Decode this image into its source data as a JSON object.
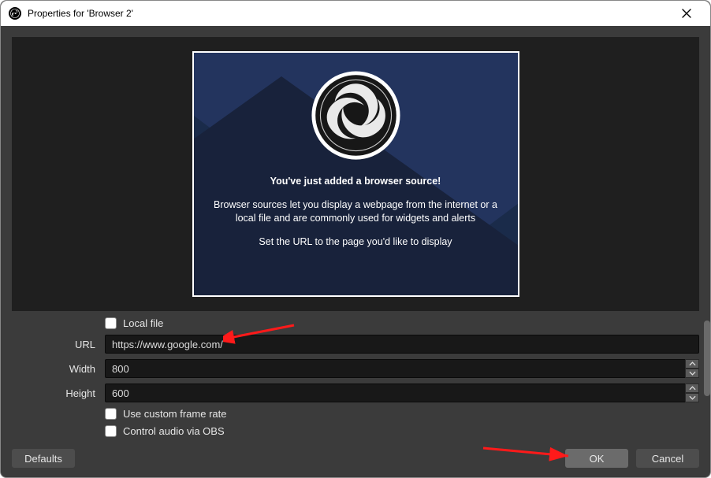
{
  "window": {
    "title": "Properties for 'Browser 2'"
  },
  "preview": {
    "headline": "You've just added a browser source!",
    "desc": "Browser sources let you display a webpage from the internet or a local file and are commonly used for widgets and alerts",
    "cta": "Set the URL to the page you'd like to display"
  },
  "form": {
    "local_file_label": "Local file",
    "url_label": "URL",
    "url_value": "https://www.google.com/",
    "width_label": "Width",
    "width_value": "800",
    "height_label": "Height",
    "height_value": "600",
    "custom_fps_label": "Use custom frame rate",
    "control_audio_label": "Control audio via OBS"
  },
  "buttons": {
    "defaults": "Defaults",
    "ok": "OK",
    "cancel": "Cancel"
  }
}
